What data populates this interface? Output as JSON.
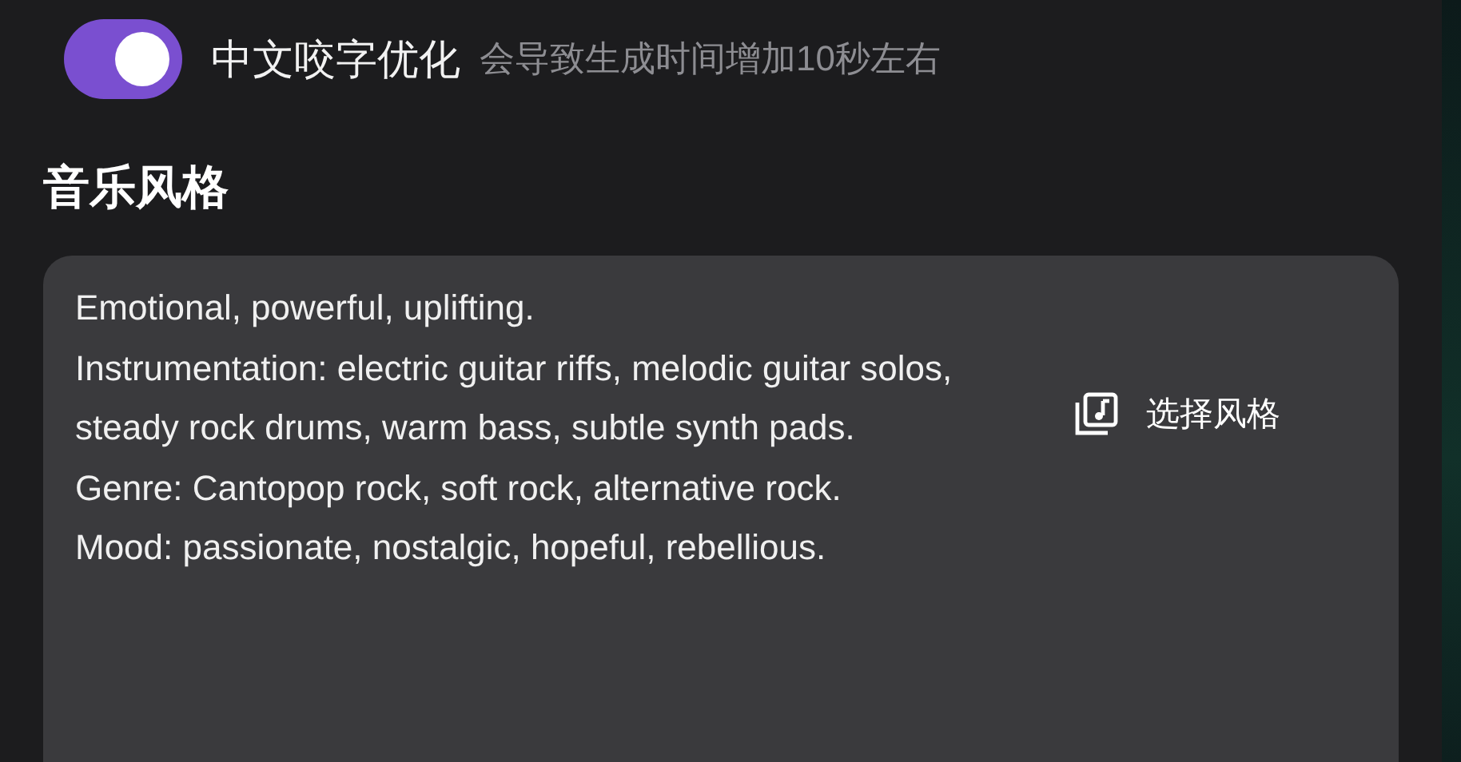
{
  "toggle": {
    "label": "中文咬字优化",
    "hint": "会导致生成时间增加10秒左右",
    "on": true
  },
  "section": {
    "title": "音乐风格"
  },
  "style_field": {
    "value": [
      "Emotional, powerful, uplifting.",
      "Instrumentation: electric guitar riffs, melodic guitar solos, steady rock drums, warm bass, subtle synth pads.",
      "Genre: Cantopop rock, soft rock, alternative rock.",
      "Mood: passionate, nostalgic, hopeful, rebellious."
    ]
  },
  "choose_button": {
    "label": "选择风格"
  }
}
